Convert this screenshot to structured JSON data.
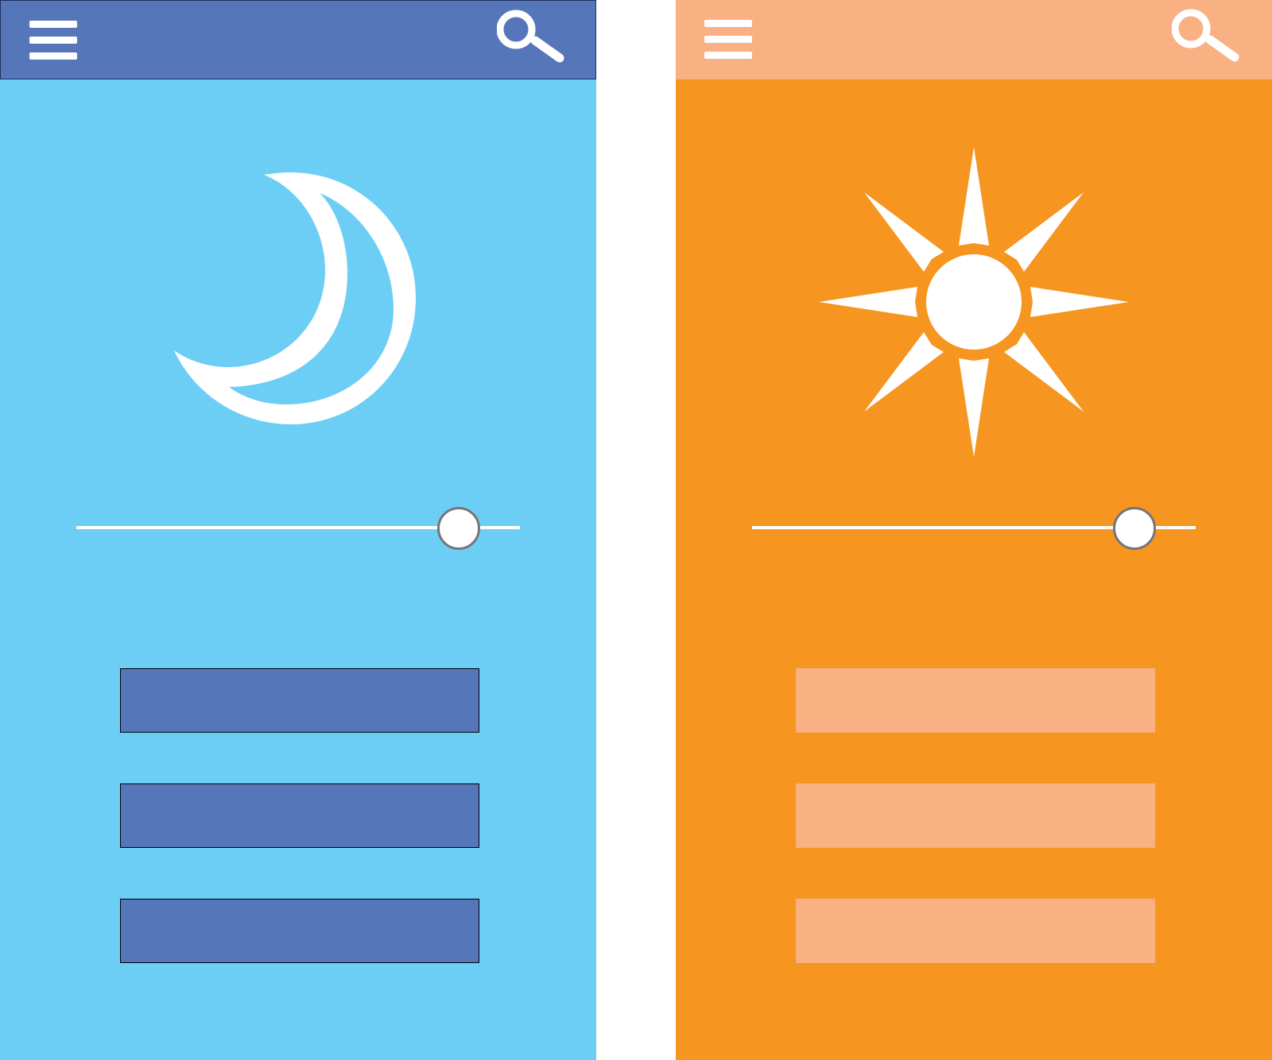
{
  "themes": {
    "night": {
      "mode": "night",
      "background_color": "#6DCEF5",
      "appbar_color": "#5676BA",
      "button_color": "#5676BA",
      "icon_color": "#FFFFFF",
      "menu_icon": "hamburger-menu-icon",
      "search_icon": "magnifier-search-icon",
      "hero_icon": "moon-icon",
      "slider_value": 0.86,
      "buttons": [
        "",
        "",
        ""
      ]
    },
    "day": {
      "mode": "day",
      "background_color": "#F6951F",
      "appbar_color": "#F9B083",
      "button_color": "#F9B083",
      "icon_color": "#FFFFFF",
      "menu_icon": "hamburger-menu-icon",
      "search_icon": "magnifier-search-icon",
      "hero_icon": "sun-icon",
      "slider_value": 0.86,
      "buttons": [
        "",
        "",
        ""
      ]
    }
  }
}
